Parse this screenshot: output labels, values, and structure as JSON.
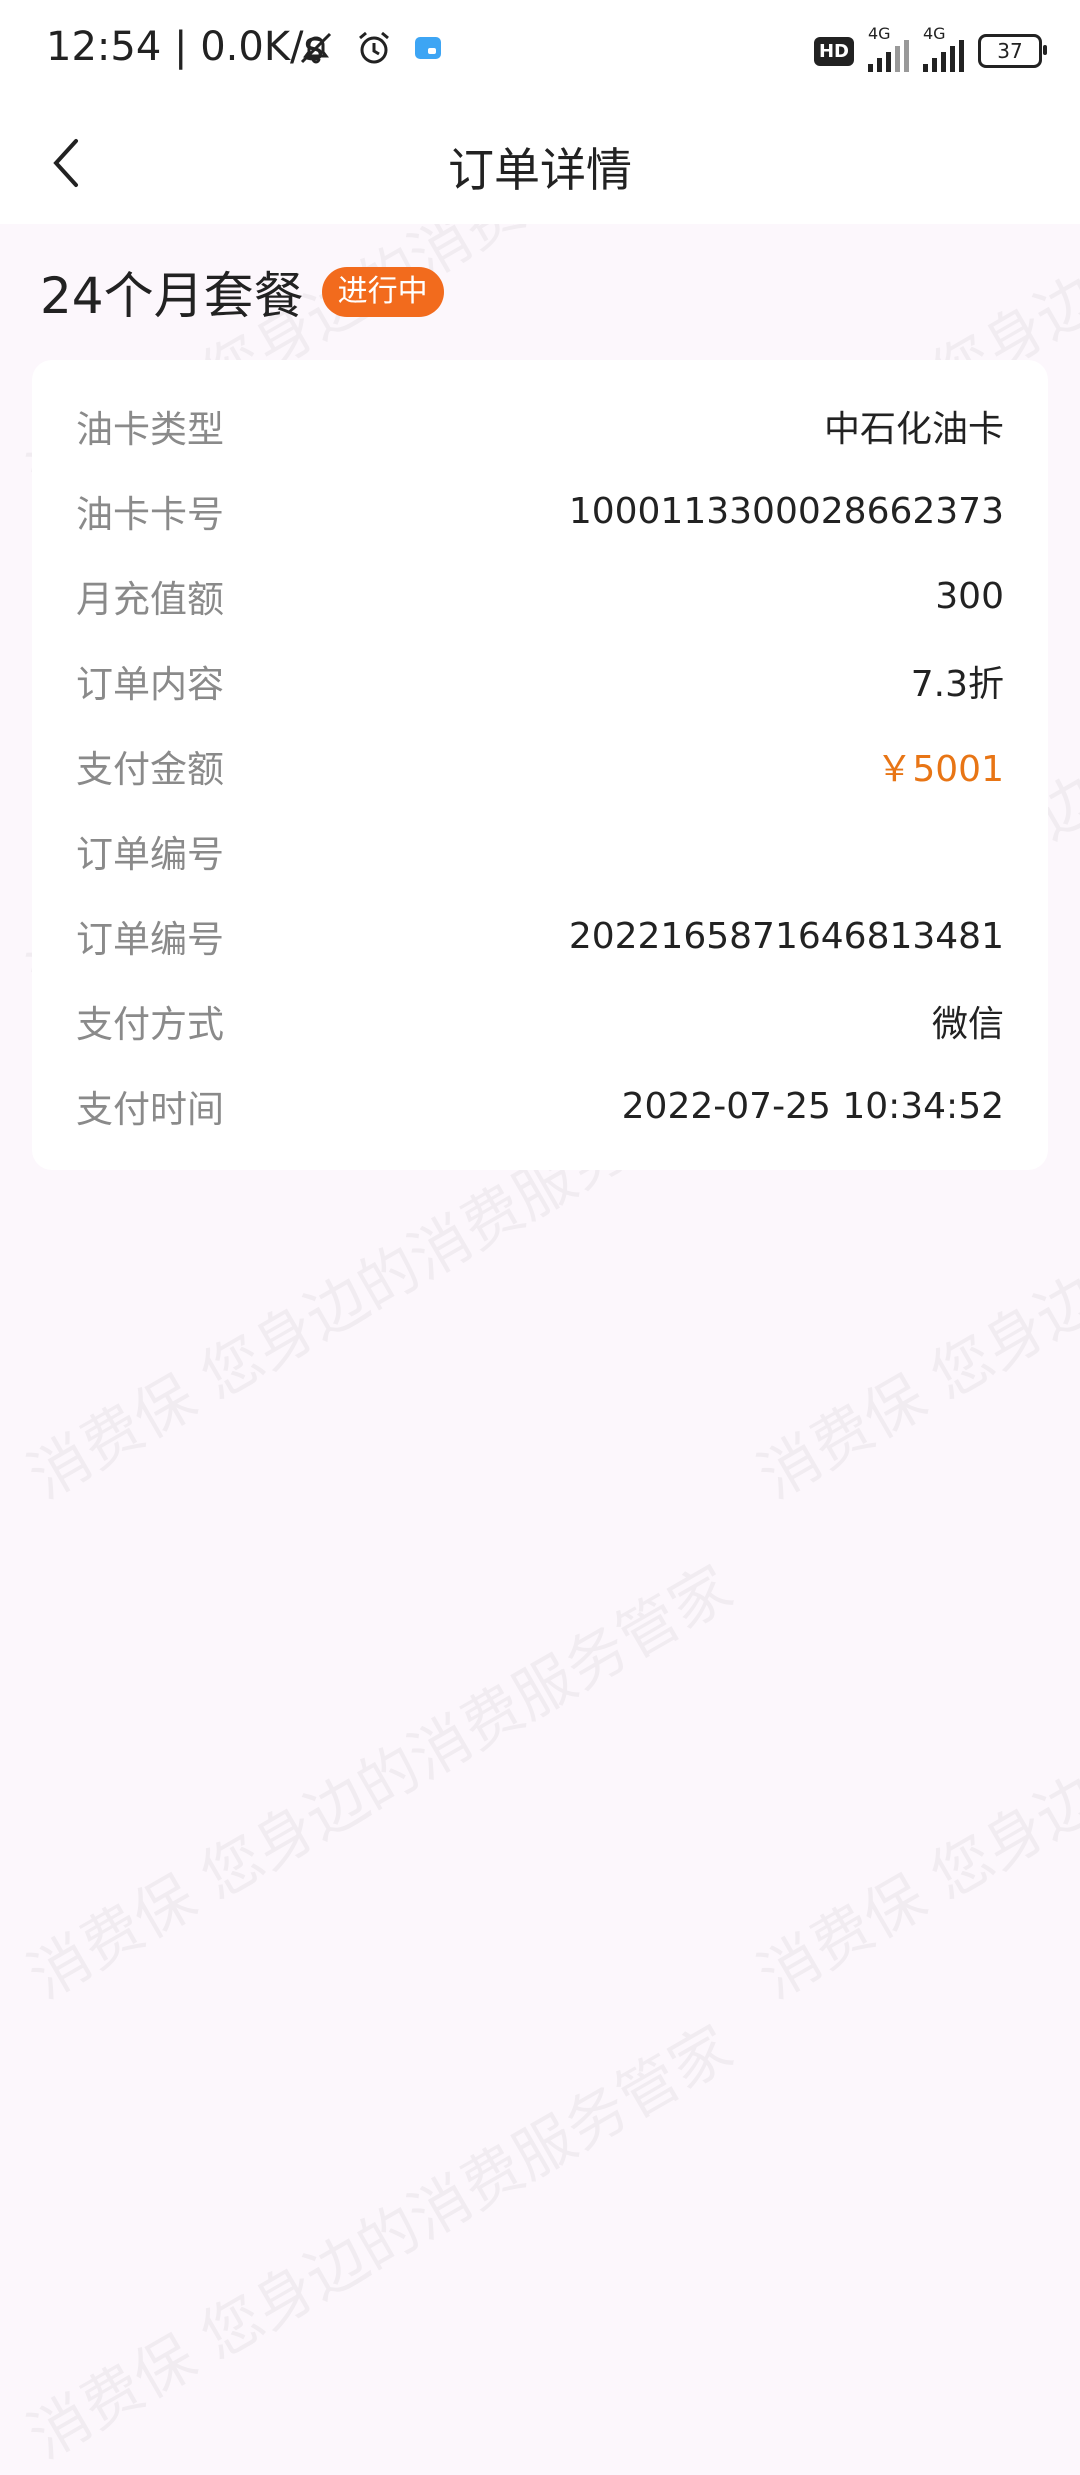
{
  "status_bar": {
    "time": "12:54",
    "speed": "0.0K/s",
    "icons": [
      "mute-icon",
      "alarm-icon",
      "app-notification-icon"
    ],
    "hd": "HD",
    "sim1": "4G",
    "sim2": "4G",
    "battery": "37"
  },
  "nav": {
    "title": "订单详情",
    "back_icon": "chevron-left-icon"
  },
  "plan": {
    "title": "24个月套餐",
    "status": "进行中"
  },
  "details": [
    {
      "label": "油卡类型",
      "value": "中石化油卡"
    },
    {
      "label": "油卡卡号",
      "value": "1000113300028662373"
    },
    {
      "label": "月充值额",
      "value": "300"
    },
    {
      "label": "订单内容",
      "value": "7.3折"
    },
    {
      "label": "支付金额",
      "value": "￥5001"
    },
    {
      "label": "订单编号",
      "value": ""
    },
    {
      "label": "订单编号",
      "value": "2022165871646813481"
    },
    {
      "label": "支付方式",
      "value": "微信"
    },
    {
      "label": "支付时间",
      "value": "2022-07-25 10:34:52"
    }
  ],
  "watermark": {
    "line1": "消费保 您身边的消费服务管家"
  },
  "colors": {
    "accent": "#E87515",
    "badge": "#F26B1D",
    "background": "#FCF7FC"
  }
}
